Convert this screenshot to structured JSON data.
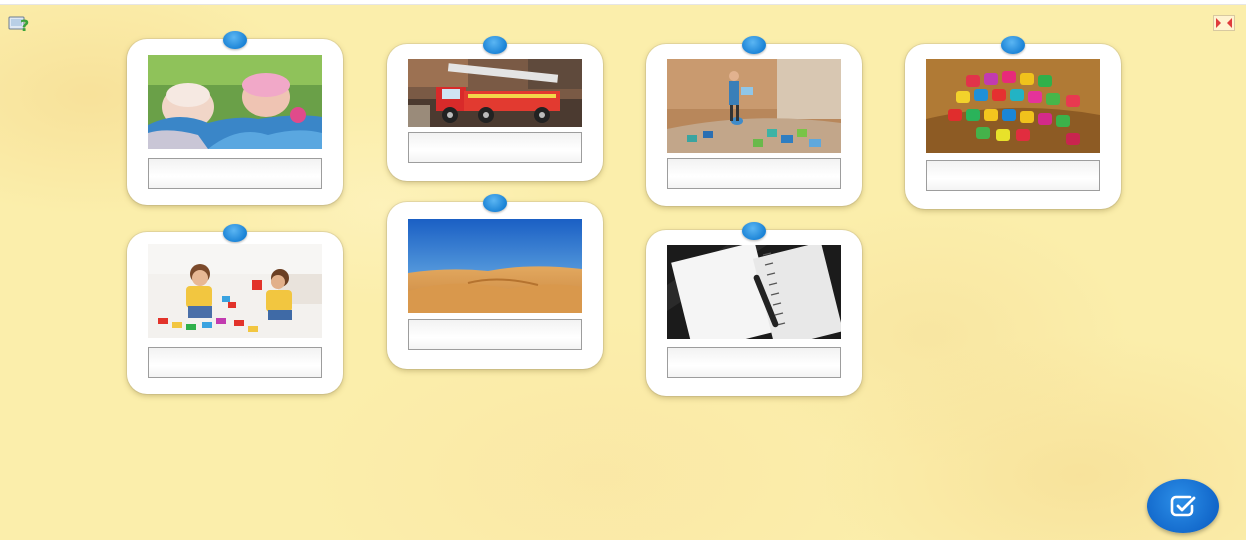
{
  "toolbar": {
    "help_icon": "help-question-icon",
    "fullscreen_icon": "fullscreen-toggle-icon"
  },
  "cards": [
    {
      "id": "baby-dolls",
      "image": "doll-babies-photo",
      "answer": ""
    },
    {
      "id": "fire-truck",
      "image": "toy-fire-truck-photo",
      "answer": ""
    },
    {
      "id": "puzzle",
      "image": "puzzle-figure-photo",
      "answer": ""
    },
    {
      "id": "cubes",
      "image": "colorful-cubes-photo",
      "answer": ""
    },
    {
      "id": "boys-playing",
      "image": "boys-playing-blocks-photo",
      "answer": ""
    },
    {
      "id": "desert",
      "image": "desert-dunes-photo",
      "answer": ""
    },
    {
      "id": "notebook",
      "image": "notebook-pen-photo",
      "answer": ""
    }
  ],
  "check_button": {
    "icon": "check-icon"
  },
  "colors": {
    "board": "#fbeeab",
    "pin": "#1b83d6",
    "check_button": "#1166c9"
  }
}
